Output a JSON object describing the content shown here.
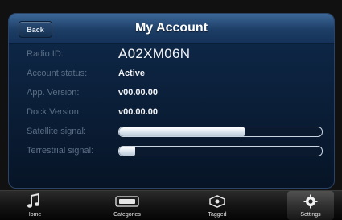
{
  "header": {
    "back_label": "Back",
    "title": "My Account"
  },
  "account": {
    "rows": [
      {
        "label": "Radio ID:",
        "value": "A02XM06N"
      },
      {
        "label": "Account status:",
        "value": "Active"
      },
      {
        "label": "App. Version:",
        "value": "v00.00.00"
      },
      {
        "label": "Dock Version:",
        "value": "v00.00.00"
      }
    ],
    "signals": [
      {
        "label": "Satellite signal:",
        "level_fraction": 0.62
      },
      {
        "label": "Terrestrial signal:",
        "level_fraction": 0.08
      }
    ]
  },
  "tabbar": {
    "tabs": [
      {
        "label": "Home",
        "icon": "music-note-icon",
        "active": false
      },
      {
        "label": "Categories",
        "icon": "sxm-logo-icon",
        "active": false
      },
      {
        "label": "Tagged",
        "icon": "tag-icon",
        "active": false
      },
      {
        "label": "Settings",
        "icon": "gear-icon",
        "active": true
      }
    ]
  },
  "colors": {
    "screen_bg": "#0f2a4c",
    "titlebar": "#3c6797",
    "label_text": "#5b6f86",
    "value_text": "#f2f4f7"
  }
}
